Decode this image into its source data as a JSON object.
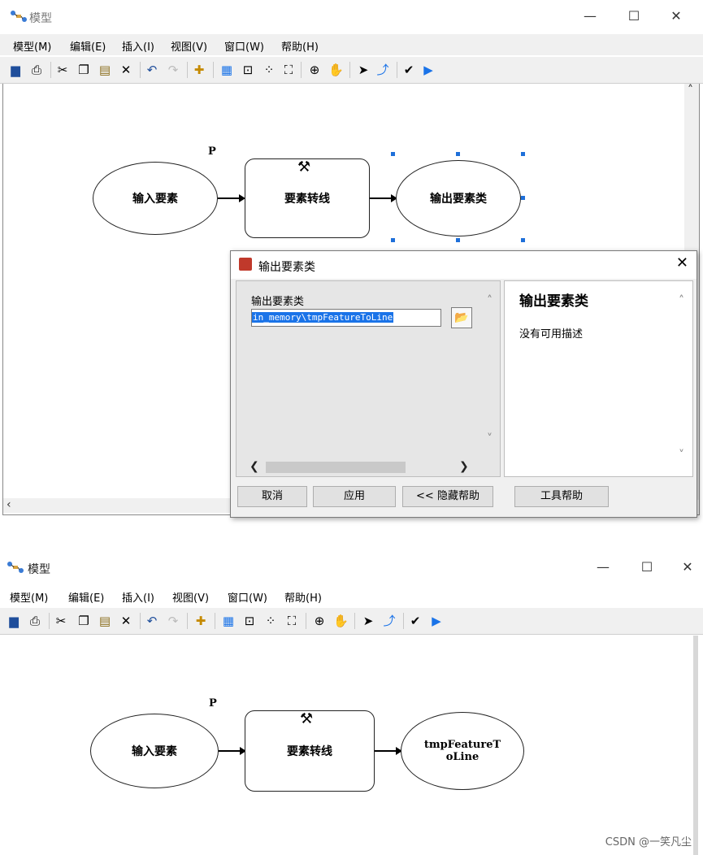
{
  "window1": {
    "title": "模型",
    "menu": [
      "模型(M)",
      "编辑(E)",
      "插入(I)",
      "视图(V)",
      "窗口(W)",
      "帮助(H)"
    ],
    "controls": {
      "minimize": "—",
      "maximize": "☐",
      "close": "✕"
    },
    "diagram": {
      "p_label": "P",
      "input_node": "输入要素",
      "tool_node": "要素转线",
      "output_node": "输出要素类"
    }
  },
  "dialog": {
    "title": "输出要素类",
    "field_label": "输出要素类",
    "field_value": "in_memory\\tmpFeatureToLine",
    "help_title": "输出要素类",
    "help_desc": "没有可用描述",
    "buttons": {
      "cancel": "取消",
      "apply": "应用",
      "hide_help": "<< 隐藏帮助",
      "tool_help": "工具帮助"
    },
    "close": "✕"
  },
  "window2": {
    "title": "模型",
    "menu": [
      "模型(M)",
      "编辑(E)",
      "插入(I)",
      "视图(V)",
      "窗口(W)",
      "帮助(H)"
    ],
    "controls": {
      "minimize": "—",
      "maximize": "☐",
      "close": "✕"
    },
    "diagram": {
      "p_label": "P",
      "input_node": "输入要素",
      "tool_node": "要素转线",
      "output_node": "tmpFeatureT oLine"
    }
  },
  "toolbar_icons": [
    "save-icon",
    "print-icon",
    "cut-icon",
    "copy-icon",
    "paste-icon",
    "delete-icon",
    "undo-icon",
    "redo-icon",
    "add-data-icon",
    "auto-layout-icon",
    "full-extent-icon",
    "zoom-in-fixed-icon",
    "zoom-out-fixed-icon",
    "zoom-in-icon",
    "pan-icon",
    "select-icon",
    "connect-icon",
    "validate-icon",
    "run-icon"
  ],
  "watermark": "CSDN @一笑凡尘"
}
